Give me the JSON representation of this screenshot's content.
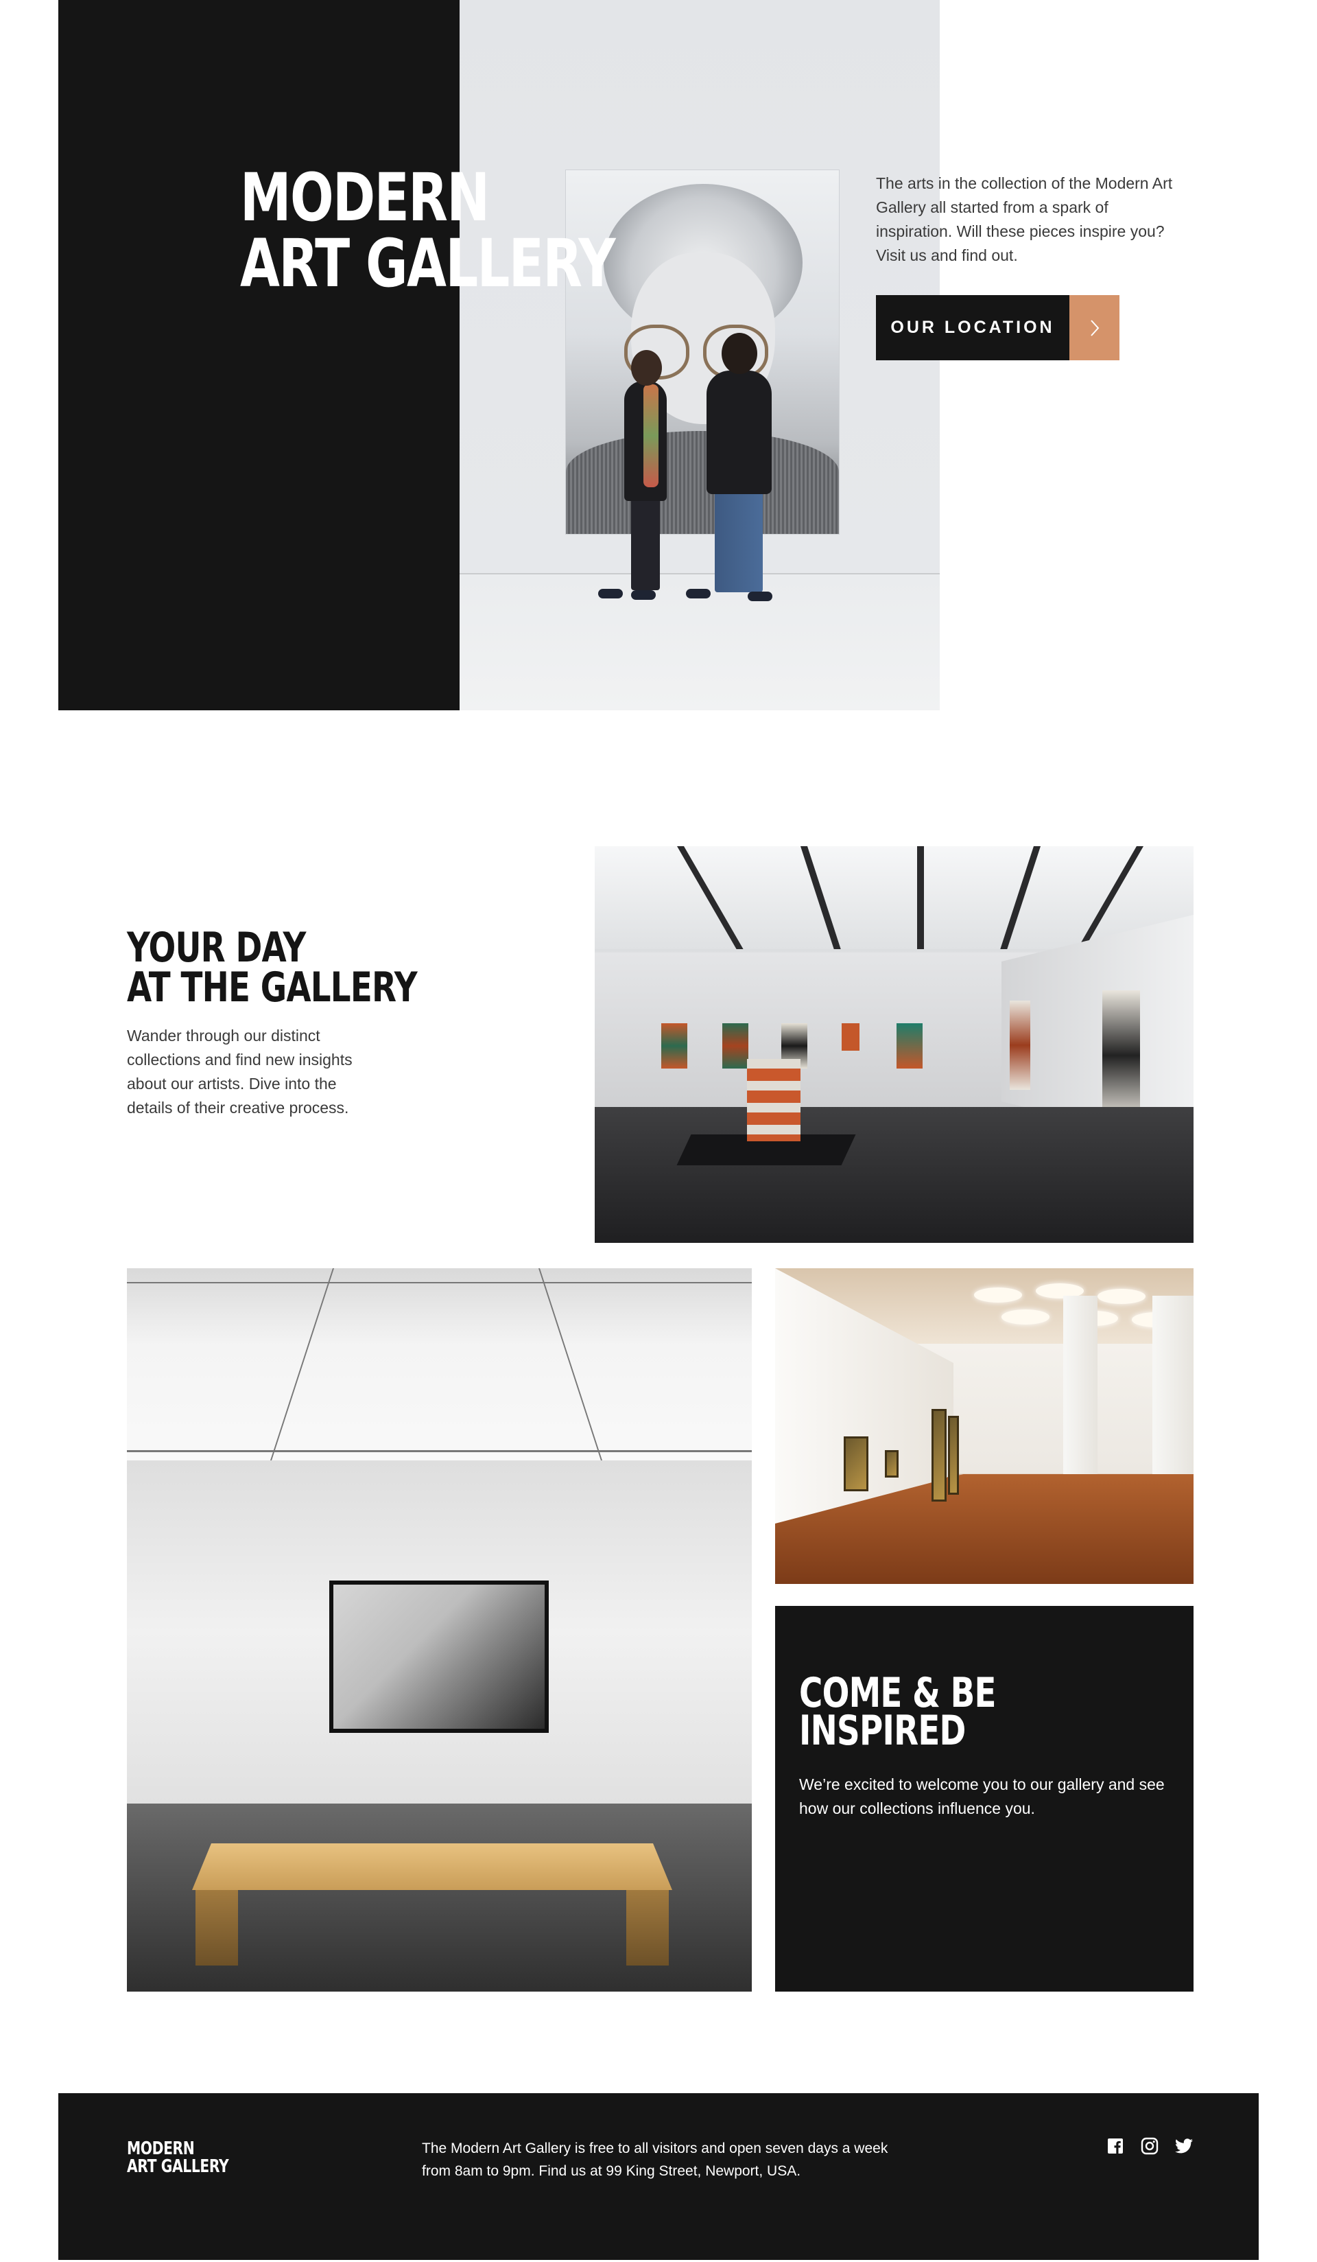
{
  "hero": {
    "title_line1": "MODERN",
    "title_line2": "ART GALLERY",
    "intro": "The arts in the collection of the Modern Art Gallery all started from a spark of inspiration. Will these pieces inspire you? Visit us and find out.",
    "cta_label": "OUR LOCATION",
    "cta_icon": "chevron-right-icon",
    "accent_color": "#d5936a",
    "dark_color": "#151515"
  },
  "day": {
    "title_line1": "YOUR DAY",
    "title_line2": "AT THE GALLERY",
    "text": "Wander through our distinct collections and find new insights about our artists. Dive into the details of their creative process."
  },
  "inspire": {
    "title_line1": "COME & BE",
    "title_line2": "INSPIRED",
    "text": "We’re excited to welcome you to our gallery and see how our collections influence you."
  },
  "footer": {
    "logo_line1": "MODERN",
    "logo_line2": "ART GALLERY",
    "text": "The Modern Art Gallery is free to all visitors and open seven days a week from 8am to 9pm. Find us at 99 King Street, Newport, USA.",
    "social_icons": [
      "facebook-icon",
      "instagram-icon",
      "twitter-icon"
    ]
  }
}
